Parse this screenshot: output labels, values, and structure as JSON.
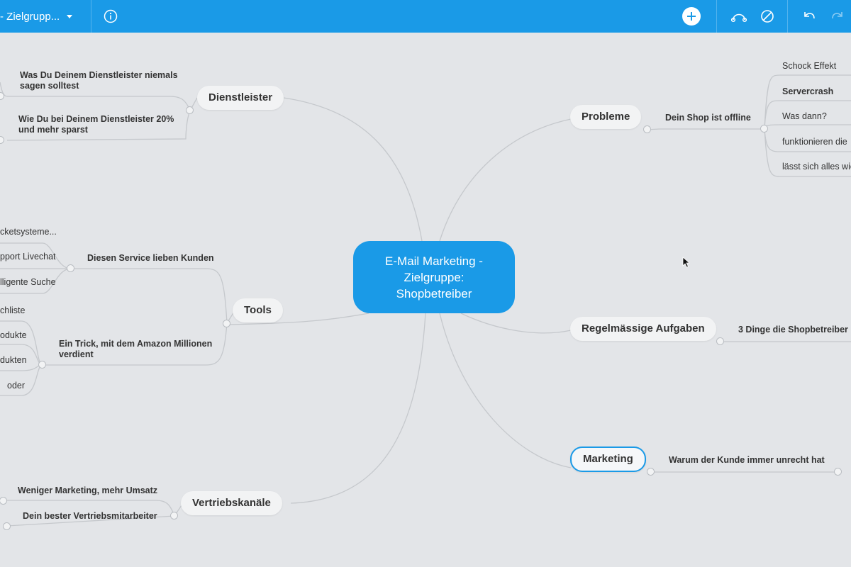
{
  "toolbar": {
    "doc_title": "- Zielgrupp...",
    "colors": {
      "bar": "#1a9ae7",
      "icon": "#ffffff"
    },
    "icons": [
      "info-icon",
      "plus-icon",
      "relationship-icon",
      "no-style-icon",
      "undo-icon",
      "redo-icon"
    ]
  },
  "map": {
    "central": {
      "lines": [
        "E-Mail Marketing -",
        "Zielgruppe:",
        "Shopbetreiber"
      ]
    },
    "left": {
      "dienstleister": {
        "label": "Dienstleister",
        "subs": [
          {
            "lines": [
              "Was Du Deinem Dienstleister niemals",
              "sagen solltest"
            ]
          },
          {
            "lines": [
              "Wie Du bei Deinem Dienstleister 20%",
              "und mehr sparst"
            ]
          }
        ]
      },
      "tools": {
        "label": "Tools",
        "sub1": {
          "label": "Diesen Service lieben Kunden",
          "leaves": [
            "cketsysteme...",
            "pport Livechat",
            "lligente Suche"
          ]
        },
        "sub2": {
          "lines": [
            "Ein Trick, mit dem Amazon Millionen",
            "verdient"
          ],
          "leaves": [
            "chliste",
            "odukte",
            "dukten",
            "oder"
          ]
        }
      },
      "vertrieb": {
        "label": "Vertriebskanäle",
        "subs": [
          "Weniger Marketing, mehr Umsatz",
          "Dein bester Vertriebsmitarbeiter"
        ]
      }
    },
    "right": {
      "probleme": {
        "label": "Probleme",
        "sub": "Dein Shop ist offline",
        "leaves": [
          "Schock Effekt",
          "Servercrash",
          "Was dann?",
          "funktionieren die",
          "lässt sich alles wie"
        ]
      },
      "aufgaben": {
        "label": "Regelmässige Aufgaben",
        "sub": "3 Dinge die Shopbetreiber"
      },
      "marketing": {
        "label": "Marketing",
        "sub": "Warum der Kunde immer unrecht hat"
      }
    }
  }
}
